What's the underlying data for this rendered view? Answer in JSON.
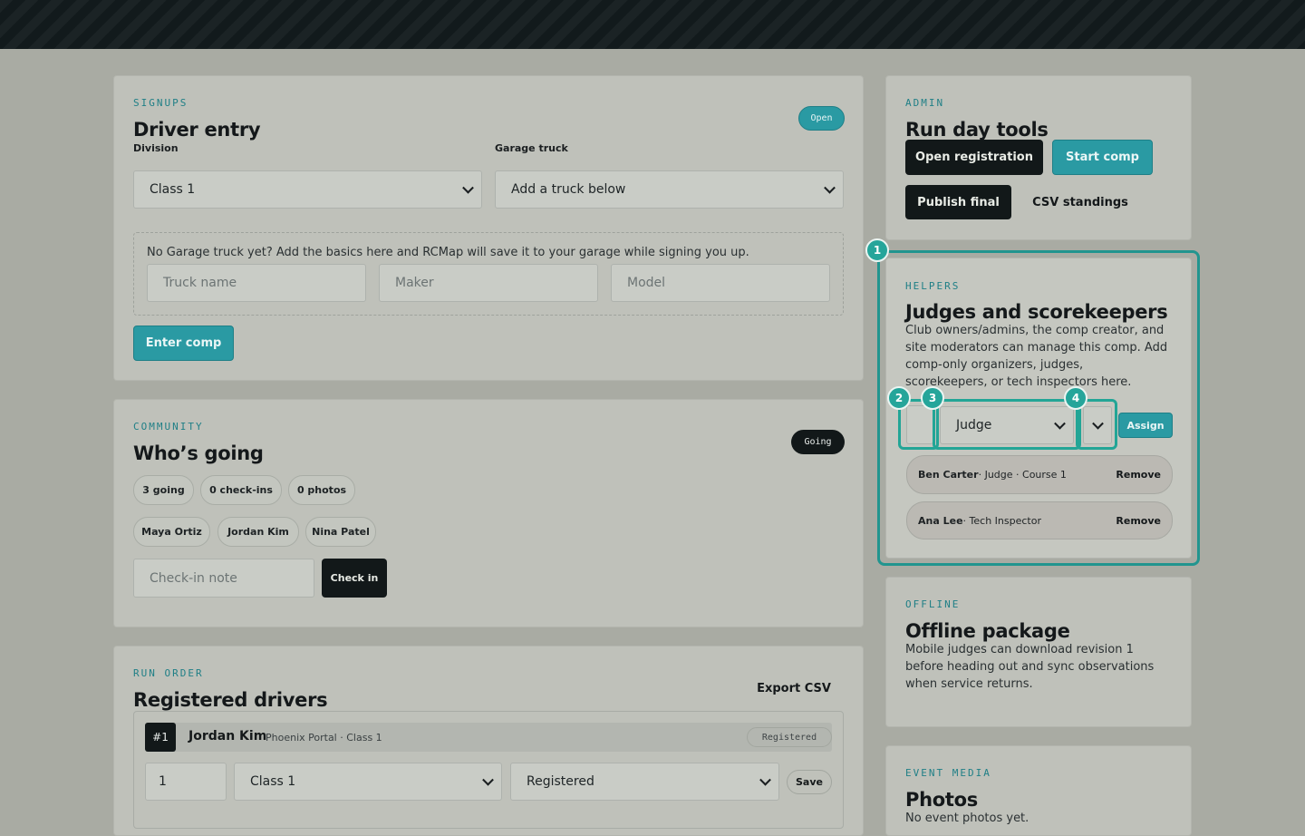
{
  "signups": {
    "eyebrow": "SIGNUPS",
    "title": "Driver entry",
    "status": "Open",
    "division_label": "Division",
    "division_value": "Class 1",
    "truck_label": "Garage truck",
    "truck_value": "Add a truck below",
    "hint": "No Garage truck yet? Add the basics here and RCMap will save it to your garage while signing you up.",
    "truck_name_placeholder": "Truck name",
    "maker_placeholder": "Maker",
    "model_placeholder": "Model",
    "enter_button": "Enter comp"
  },
  "community": {
    "eyebrow": "COMMUNITY",
    "title": "Who’s going",
    "status": "Going",
    "stats": [
      "3 going",
      "0 check-ins",
      "0 photos"
    ],
    "attendees": [
      "Maya Ortiz",
      "Jordan Kim",
      "Nina Patel"
    ],
    "note_placeholder": "Check-in note",
    "checkin_button": "Check in"
  },
  "run_order": {
    "eyebrow": "RUN ORDER",
    "title": "Registered drivers",
    "export_button": "Export CSV",
    "driver": {
      "position": "#1",
      "name": "Jordan Kim",
      "meta": "Phoenix Portal · Class 1",
      "status": "Registered",
      "order_value": "1",
      "class_value": "Class 1",
      "status_value": "Registered",
      "save_button": "Save"
    }
  },
  "admin": {
    "eyebrow": "ADMIN",
    "title": "Run day tools",
    "buttons": [
      "Open registration",
      "Start comp",
      "Publish final",
      "CSV standings"
    ]
  },
  "helpers": {
    "eyebrow": "HELPERS",
    "title": "Judges and scorekeepers",
    "description": "Club owners/admins, the comp creator, and site moderators can manage this comp. Add comp-only organizers, judges, scorekeepers, or tech inspectors here.",
    "role_value": "Judge",
    "assign_button": "Assign",
    "remove_label": "Remove",
    "members": [
      {
        "bold": "Ben Carter",
        "rest": " · Judge · Course 1"
      },
      {
        "bold": "Ana Lee",
        "rest": " · Tech Inspector"
      }
    ],
    "markers": [
      "1",
      "2",
      "3",
      "4"
    ]
  },
  "offline": {
    "eyebrow": "OFFLINE",
    "title": "Offline package",
    "description": "Mobile judges can download revision 1 before heading out and sync observations when service returns."
  },
  "media": {
    "eyebrow": "EVENT MEDIA",
    "title": "Photos",
    "description": "No event photos yet."
  }
}
